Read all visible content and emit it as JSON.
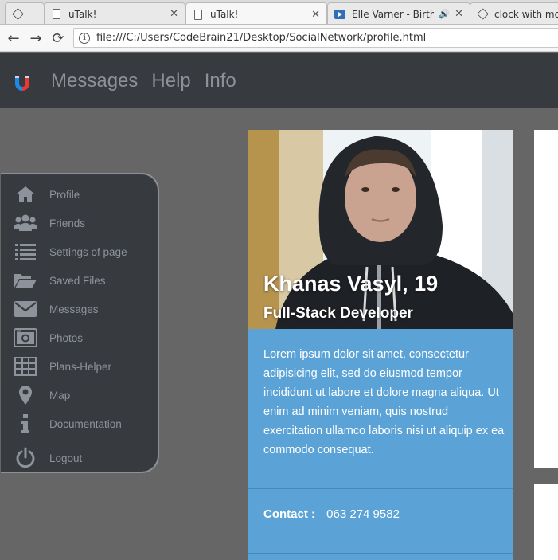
{
  "browser": {
    "tabs": [
      {
        "title": "",
        "favicon": "codepen-icon"
      },
      {
        "title": "uTalk!",
        "favicon": "page-icon"
      },
      {
        "title": "uTalk!",
        "favicon": "page-icon",
        "active": true
      },
      {
        "title": "Elle Varner - Birthd",
        "favicon": "youtube-icon"
      },
      {
        "title": "clock with mom",
        "favicon": "codepen-icon"
      }
    ],
    "url": "file:///C:/Users/CodeBrain21/Desktop/SocialNetwork/profile.html"
  },
  "header": {
    "nav": [
      "Messages",
      "Help",
      "Info"
    ]
  },
  "sidebar": {
    "items": [
      {
        "label": "Profile",
        "icon": "home-icon"
      },
      {
        "label": "Friends",
        "icon": "users-icon"
      },
      {
        "label": "Settings of page",
        "icon": "list-icon"
      },
      {
        "label": "Saved Files",
        "icon": "folder-open-icon"
      },
      {
        "label": "Messages",
        "icon": "envelope-icon"
      },
      {
        "label": "Photos",
        "icon": "camera-icon"
      },
      {
        "label": "Plans-Helper",
        "icon": "table-icon"
      },
      {
        "label": "Map",
        "icon": "map-marker-icon"
      },
      {
        "label": "Documentation",
        "icon": "info-icon"
      },
      {
        "label": "Logout",
        "icon": "power-icon"
      }
    ]
  },
  "profile": {
    "name": "Khanas Vasyl, 19",
    "role": "Full-Stack Developer",
    "bio": "Lorem ipsum dolor sit amet, consectetur adipisicing elit, sed do eiusmod tempor incididunt ut labore et dolore magna aliqua. Ut enim ad minim veniam, quis nostrud exercitation ullamco laboris nisi ut aliquip ex ea commodo consequat.",
    "contact_label": "Contact :",
    "contact_value": "063 274 9582"
  },
  "colors": {
    "header_bg": "#373b40",
    "page_bg": "#666666",
    "card_bg": "#5ba3d6",
    "nav_text": "#8d9096",
    "logo_blue": "#1e88e5",
    "logo_red": "#e53935"
  }
}
